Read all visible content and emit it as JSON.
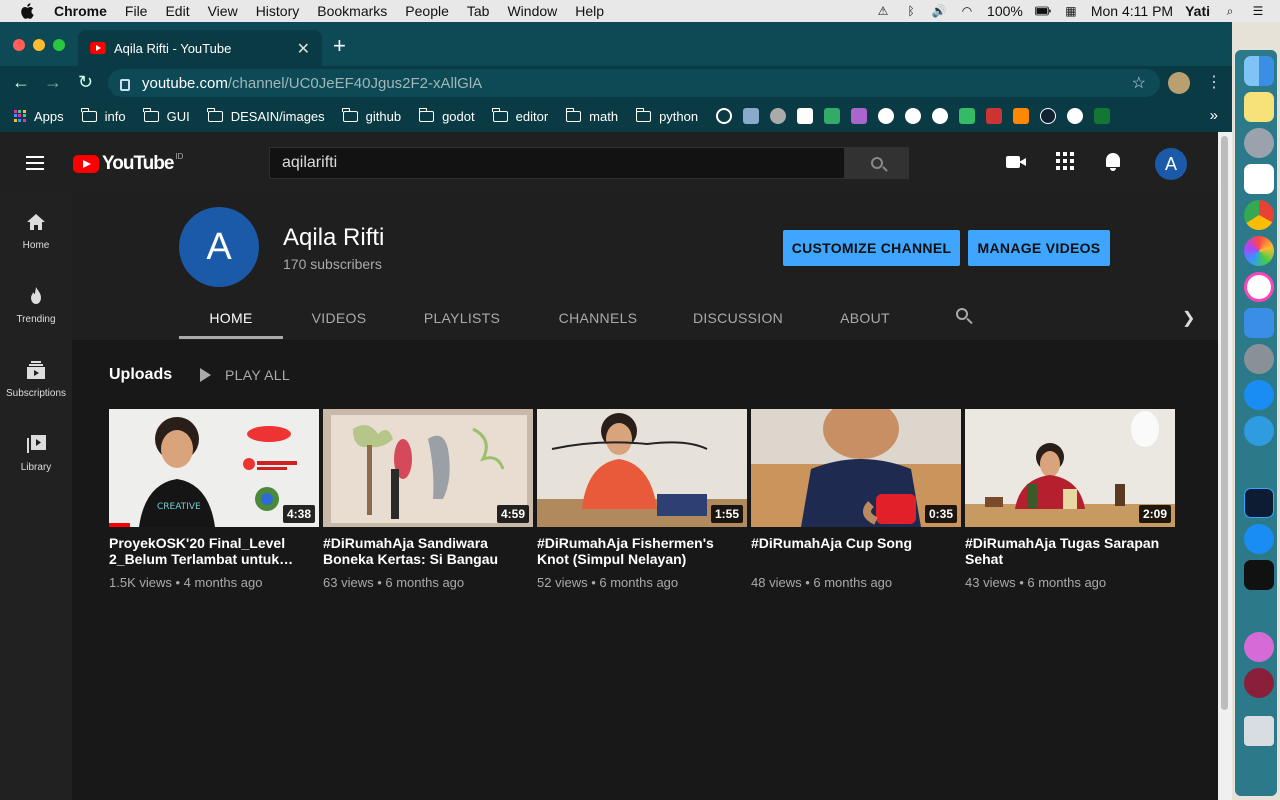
{
  "menubar": {
    "app": "Chrome",
    "items": [
      "File",
      "Edit",
      "View",
      "History",
      "Bookmarks",
      "People",
      "Tab",
      "Window",
      "Help"
    ],
    "battery": "100%",
    "clock": "Mon 4:11 PM",
    "user": "Yati"
  },
  "browser": {
    "tab_title": "Aqila Rifti - YouTube",
    "url_host": "youtube.com",
    "url_path": "/channel/UC0JeEF40Jgus2F2-xAllGlA",
    "bookmarks": [
      "Apps",
      "info",
      "GUI",
      "DESAIN/images",
      "github",
      "godot",
      "editor",
      "math",
      "python"
    ],
    "bookmark_more": "»"
  },
  "youtube": {
    "logo_text": "YouTube",
    "country": "ID",
    "search_value": "aqilarifti",
    "account_initial": "A",
    "sidebar": [
      {
        "label": "Home",
        "icon": "home-icon"
      },
      {
        "label": "Trending",
        "icon": "trending-icon"
      },
      {
        "label": "Subscriptions",
        "icon": "subscriptions-icon"
      },
      {
        "label": "Library",
        "icon": "library-icon"
      }
    ],
    "channel": {
      "initial": "A",
      "name": "Aqila Rifti",
      "subscribers": "170 subscribers",
      "customize_label": "CUSTOMIZE CHANNEL",
      "manage_label": "MANAGE VIDEOS",
      "tabs": [
        "HOME",
        "VIDEOS",
        "PLAYLISTS",
        "CHANNELS",
        "DISCUSSION",
        "ABOUT"
      ],
      "active_tab": "HOME"
    },
    "uploads": {
      "title": "Uploads",
      "play_all": "PLAY ALL",
      "videos": [
        {
          "title": "ProyekOSK'20 Final_Level 2_Belum Terlambat untuk…",
          "duration": "4:38",
          "views": "1.5K views",
          "age": "4 months ago",
          "watched": 0.1
        },
        {
          "title": "#DiRumahAja Sandiwara Boneka Kertas: Si Bangau",
          "duration": "4:59",
          "views": "63 views",
          "age": "6 months ago"
        },
        {
          "title": "#DiRumahAja Fishermen's Knot (Simpul Nelayan)",
          "duration": "1:55",
          "views": "52 views",
          "age": "6 months ago"
        },
        {
          "title": "#DiRumahAja Cup Song",
          "duration": "0:35",
          "views": "48 views",
          "age": "6 months ago"
        },
        {
          "title": "#DiRumahAja Tugas Sarapan Sehat",
          "duration": "2:09",
          "views": "43 views",
          "age": "6 months ago"
        }
      ]
    }
  },
  "colors": {
    "accent_blue": "#3ea6ff",
    "youtube_red": "#ff0000",
    "chrome_theme": "#0d4a55"
  }
}
